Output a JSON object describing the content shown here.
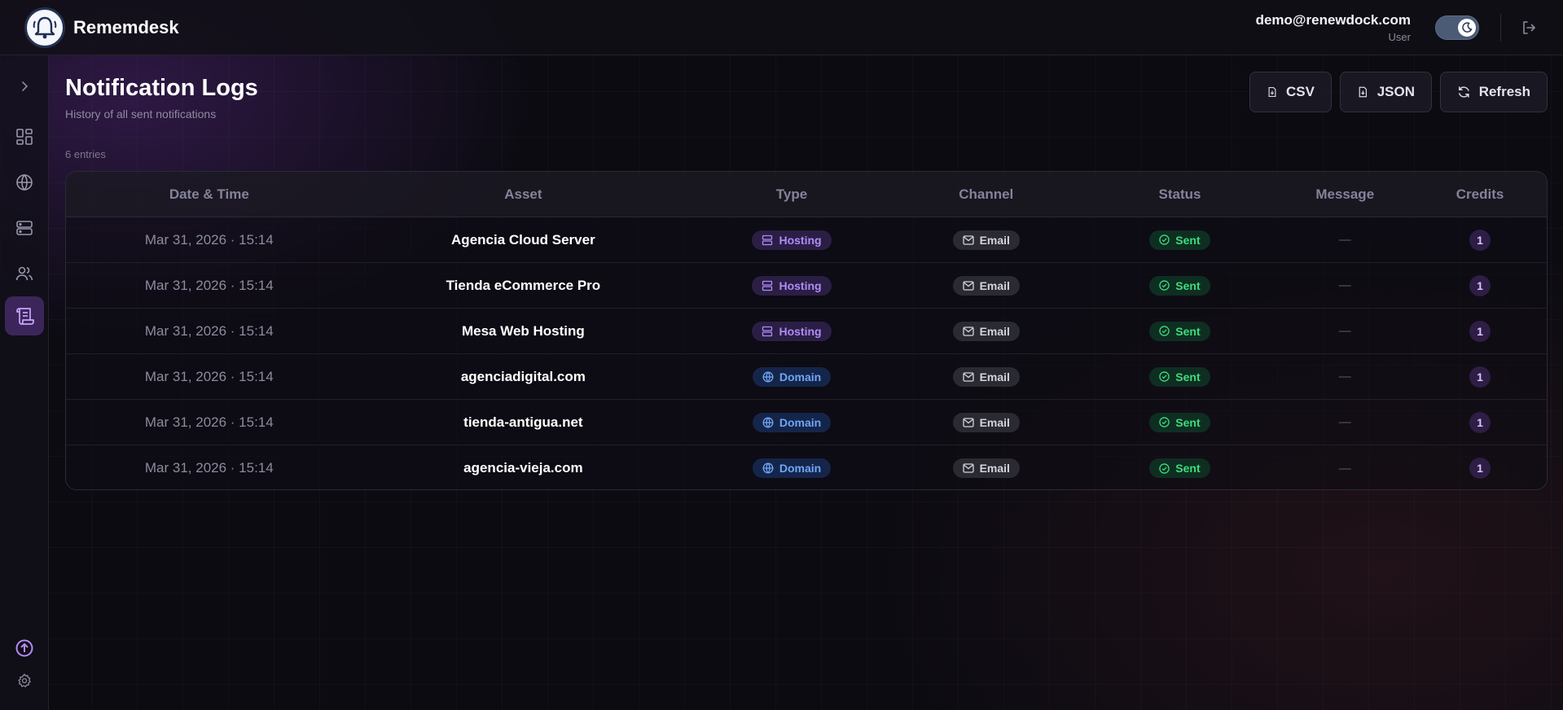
{
  "app": {
    "name": "Rememdesk"
  },
  "user": {
    "email": "demo@renewdock.com",
    "role": "User"
  },
  "sidebar": {
    "items": [
      {
        "name": "expand",
        "icon": "chevron-right-icon"
      },
      {
        "name": "dashboard",
        "icon": "dashboard-icon"
      },
      {
        "name": "domains",
        "icon": "globe-icon"
      },
      {
        "name": "hosting",
        "icon": "server-icon"
      },
      {
        "name": "users",
        "icon": "users-icon"
      },
      {
        "name": "notification-logs",
        "icon": "scroll-icon",
        "active": true
      }
    ],
    "bottom": [
      {
        "name": "upgrade",
        "icon": "arrow-up-circle-icon"
      },
      {
        "name": "settings",
        "icon": "gear-icon"
      }
    ]
  },
  "page": {
    "title": "Notification Logs",
    "subtitle": "History of all sent notifications",
    "entries": "6 entries"
  },
  "actions": {
    "csv": "CSV",
    "json": "JSON",
    "refresh": "Refresh"
  },
  "table": {
    "columns": [
      "Date & Time",
      "Asset",
      "Type",
      "Channel",
      "Status",
      "Message",
      "Credits"
    ],
    "rows": [
      {
        "date": "Mar 31, 2026 · 15:14",
        "asset": "Agencia Cloud Server",
        "type": "Hosting",
        "channel": "Email",
        "status": "Sent",
        "message": "—",
        "credits": "1"
      },
      {
        "date": "Mar 31, 2026 · 15:14",
        "asset": "Tienda eCommerce Pro",
        "type": "Hosting",
        "channel": "Email",
        "status": "Sent",
        "message": "—",
        "credits": "1"
      },
      {
        "date": "Mar 31, 2026 · 15:14",
        "asset": "Mesa Web Hosting",
        "type": "Hosting",
        "channel": "Email",
        "status": "Sent",
        "message": "—",
        "credits": "1"
      },
      {
        "date": "Mar 31, 2026 · 15:14",
        "asset": "agenciadigital.com",
        "type": "Domain",
        "channel": "Email",
        "status": "Sent",
        "message": "—",
        "credits": "1"
      },
      {
        "date": "Mar 31, 2026 · 15:14",
        "asset": "tienda-antigua.net",
        "type": "Domain",
        "channel": "Email",
        "status": "Sent",
        "message": "—",
        "credits": "1"
      },
      {
        "date": "Mar 31, 2026 · 15:14",
        "asset": "agencia-vieja.com",
        "type": "Domain",
        "channel": "Email",
        "status": "Sent",
        "message": "—",
        "credits": "1"
      }
    ]
  },
  "colors": {
    "accent": "#a46cf0",
    "hosting": "#b08cf5",
    "domain": "#6ea6f4",
    "sent": "#3ddc7c"
  }
}
